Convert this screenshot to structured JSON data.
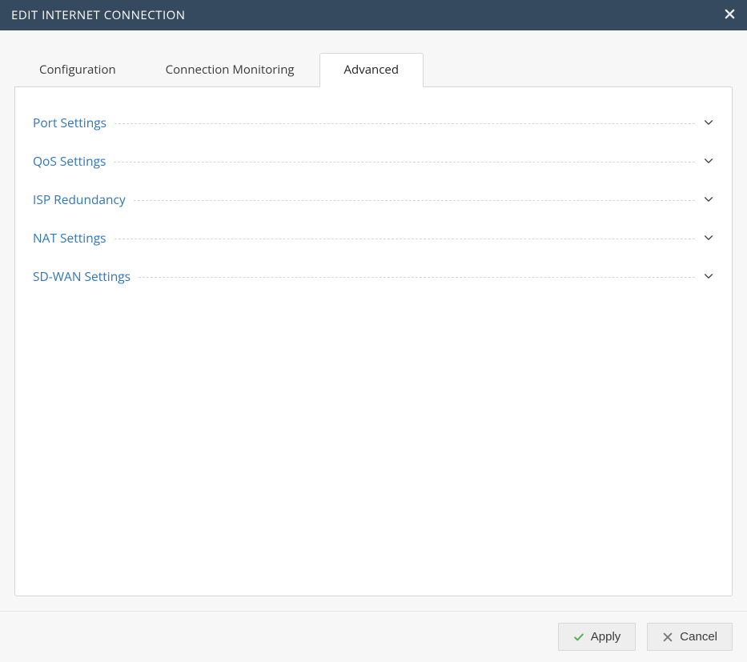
{
  "header": {
    "title": "EDIT INTERNET CONNECTION"
  },
  "tabs": [
    {
      "label": "Configuration",
      "active": false
    },
    {
      "label": "Connection Monitoring",
      "active": false
    },
    {
      "label": "Advanced",
      "active": true
    }
  ],
  "accordion": [
    {
      "label": "Port Settings"
    },
    {
      "label": "QoS Settings"
    },
    {
      "label": "ISP Redundancy"
    },
    {
      "label": "NAT Settings"
    },
    {
      "label": "SD-WAN Settings"
    }
  ],
  "footer": {
    "apply": "Apply",
    "cancel": "Cancel"
  }
}
